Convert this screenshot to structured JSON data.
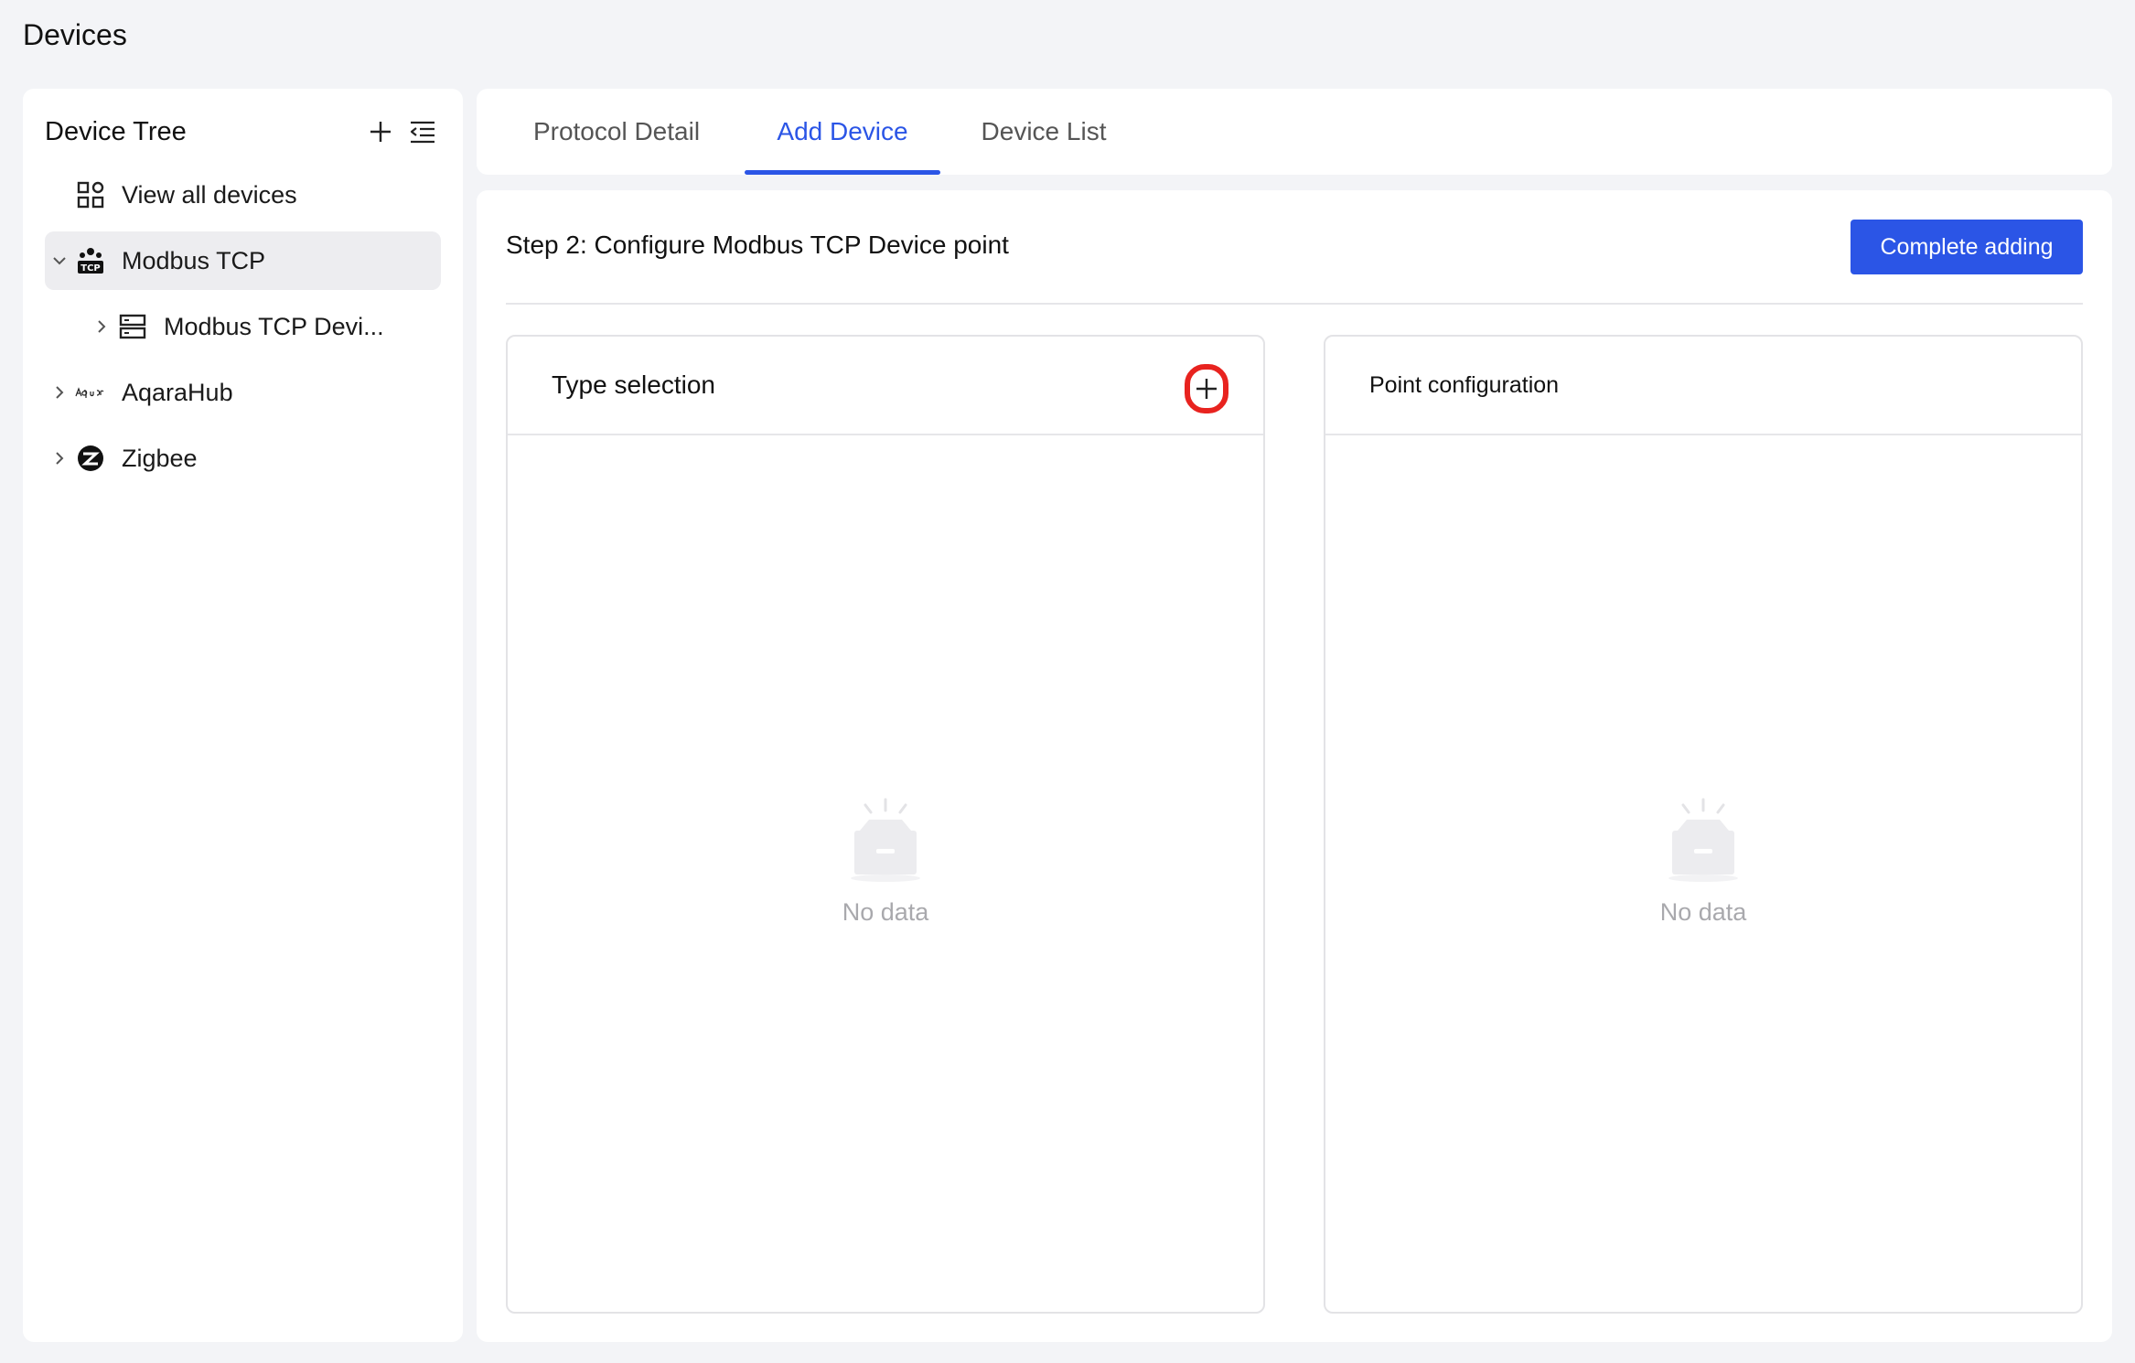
{
  "page": {
    "title": "Devices"
  },
  "sidebar": {
    "title": "Device Tree",
    "items": [
      {
        "label": "View all devices",
        "icon": "grid-icon",
        "level": 0
      },
      {
        "label": "Modbus TCP",
        "icon": "tcp-network-icon",
        "level": 1,
        "expanded": true,
        "selected": true
      },
      {
        "label": "Modbus TCP Devi...",
        "icon": "server-icon",
        "level": 2
      },
      {
        "label": "AqaraHub",
        "icon": "aqara-logo-icon",
        "level": 1
      },
      {
        "label": "Zigbee",
        "icon": "zigbee-logo-icon",
        "level": 1
      }
    ]
  },
  "tabs": [
    {
      "label": "Protocol Detail",
      "active": false
    },
    {
      "label": "Add Device",
      "active": true
    },
    {
      "label": "Device List",
      "active": false
    }
  ],
  "main": {
    "step_title": "Step 2: Configure Modbus TCP Device point",
    "complete_button": "Complete adding",
    "type_panel": {
      "title": "Type selection",
      "empty_text": "No data"
    },
    "point_panel": {
      "title": "Point configuration",
      "empty_text": "No data"
    }
  },
  "colors": {
    "accent": "#2b55e6",
    "highlight": "#e8231f",
    "selected_bg": "#ededf0"
  }
}
